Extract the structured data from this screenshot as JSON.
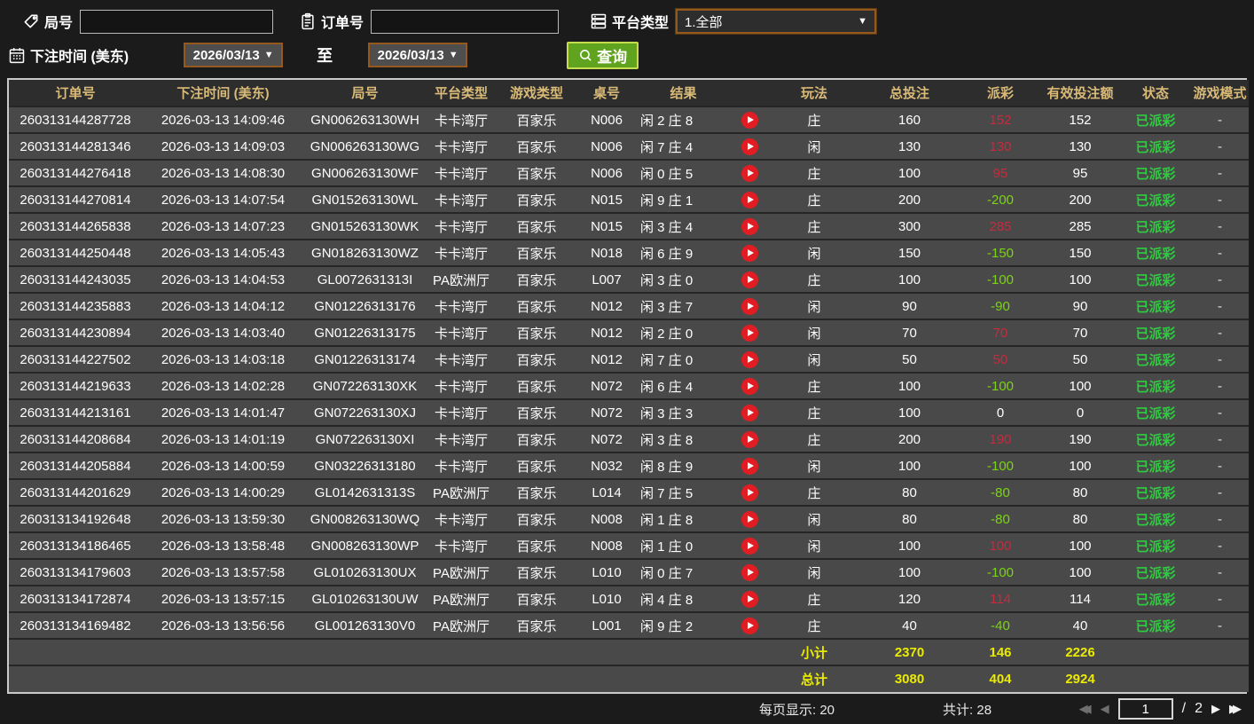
{
  "filters": {
    "round_label": "局号",
    "round_value": "",
    "order_label": "订单号",
    "order_value": "",
    "platform_label": "平台类型",
    "platform_value": "1.全部",
    "bet_time_label": "下注时间 (美东)",
    "date_from": "2026/03/13",
    "to_label": "至",
    "date_to": "2026/03/13",
    "search_label": "查询"
  },
  "table": {
    "columns": [
      "订单号",
      "下注时间 (美东)",
      "局号",
      "平台类型",
      "游戏类型",
      "桌号",
      "结果",
      "",
      "玩法",
      "总投注",
      "派彩",
      "有效投注额",
      "状态",
      "游戏模式"
    ],
    "rows": [
      {
        "order": "260313144287728",
        "time": "2026-03-13 14:09:46",
        "round": "GN006263130WH",
        "platform": "卡卡湾厅",
        "game": "百家乐",
        "table": "N006",
        "result": "闲 2 庄 8",
        "bet": "庄",
        "total": "160",
        "payout": "152",
        "valid": "152",
        "status": "已派彩",
        "mode": "-"
      },
      {
        "order": "260313144281346",
        "time": "2026-03-13 14:09:03",
        "round": "GN006263130WG",
        "platform": "卡卡湾厅",
        "game": "百家乐",
        "table": "N006",
        "result": "闲 7 庄 4",
        "bet": "闲",
        "total": "130",
        "payout": "130",
        "valid": "130",
        "status": "已派彩",
        "mode": "-"
      },
      {
        "order": "260313144276418",
        "time": "2026-03-13 14:08:30",
        "round": "GN006263130WF",
        "platform": "卡卡湾厅",
        "game": "百家乐",
        "table": "N006",
        "result": "闲 0 庄 5",
        "bet": "庄",
        "total": "100",
        "payout": "95",
        "valid": "95",
        "status": "已派彩",
        "mode": "-"
      },
      {
        "order": "260313144270814",
        "time": "2026-03-13 14:07:54",
        "round": "GN015263130WL",
        "platform": "卡卡湾厅",
        "game": "百家乐",
        "table": "N015",
        "result": "闲 9 庄 1",
        "bet": "庄",
        "total": "200",
        "payout": "-200",
        "valid": "200",
        "status": "已派彩",
        "mode": "-"
      },
      {
        "order": "260313144265838",
        "time": "2026-03-13 14:07:23",
        "round": "GN015263130WK",
        "platform": "卡卡湾厅",
        "game": "百家乐",
        "table": "N015",
        "result": "闲 3 庄 4",
        "bet": "庄",
        "total": "300",
        "payout": "285",
        "valid": "285",
        "status": "已派彩",
        "mode": "-"
      },
      {
        "order": "260313144250448",
        "time": "2026-03-13 14:05:43",
        "round": "GN018263130WZ",
        "platform": "卡卡湾厅",
        "game": "百家乐",
        "table": "N018",
        "result": "闲 6 庄 9",
        "bet": "闲",
        "total": "150",
        "payout": "-150",
        "valid": "150",
        "status": "已派彩",
        "mode": "-"
      },
      {
        "order": "260313144243035",
        "time": "2026-03-13 14:04:53",
        "round": "GL0072631313I",
        "platform": "PA欧洲厅",
        "game": "百家乐",
        "table": "L007",
        "result": "闲 3 庄 0",
        "bet": "庄",
        "total": "100",
        "payout": "-100",
        "valid": "100",
        "status": "已派彩",
        "mode": "-"
      },
      {
        "order": "260313144235883",
        "time": "2026-03-13 14:04:12",
        "round": "GN01226313176",
        "platform": "卡卡湾厅",
        "game": "百家乐",
        "table": "N012",
        "result": "闲 3 庄 7",
        "bet": "闲",
        "total": "90",
        "payout": "-90",
        "valid": "90",
        "status": "已派彩",
        "mode": "-"
      },
      {
        "order": "260313144230894",
        "time": "2026-03-13 14:03:40",
        "round": "GN01226313175",
        "platform": "卡卡湾厅",
        "game": "百家乐",
        "table": "N012",
        "result": "闲 2 庄 0",
        "bet": "闲",
        "total": "70",
        "payout": "70",
        "valid": "70",
        "status": "已派彩",
        "mode": "-"
      },
      {
        "order": "260313144227502",
        "time": "2026-03-13 14:03:18",
        "round": "GN01226313174",
        "platform": "卡卡湾厅",
        "game": "百家乐",
        "table": "N012",
        "result": "闲 7 庄 0",
        "bet": "闲",
        "total": "50",
        "payout": "50",
        "valid": "50",
        "status": "已派彩",
        "mode": "-"
      },
      {
        "order": "260313144219633",
        "time": "2026-03-13 14:02:28",
        "round": "GN072263130XK",
        "platform": "卡卡湾厅",
        "game": "百家乐",
        "table": "N072",
        "result": "闲 6 庄 4",
        "bet": "庄",
        "total": "100",
        "payout": "-100",
        "valid": "100",
        "status": "已派彩",
        "mode": "-"
      },
      {
        "order": "260313144213161",
        "time": "2026-03-13 14:01:47",
        "round": "GN072263130XJ",
        "platform": "卡卡湾厅",
        "game": "百家乐",
        "table": "N072",
        "result": "闲 3 庄 3",
        "bet": "庄",
        "total": "100",
        "payout": "0",
        "valid": "0",
        "status": "已派彩",
        "mode": "-"
      },
      {
        "order": "260313144208684",
        "time": "2026-03-13 14:01:19",
        "round": "GN072263130XI",
        "platform": "卡卡湾厅",
        "game": "百家乐",
        "table": "N072",
        "result": "闲 3 庄 8",
        "bet": "庄",
        "total": "200",
        "payout": "190",
        "valid": "190",
        "status": "已派彩",
        "mode": "-"
      },
      {
        "order": "260313144205884",
        "time": "2026-03-13 14:00:59",
        "round": "GN03226313180",
        "platform": "卡卡湾厅",
        "game": "百家乐",
        "table": "N032",
        "result": "闲 8 庄 9",
        "bet": "闲",
        "total": "100",
        "payout": "-100",
        "valid": "100",
        "status": "已派彩",
        "mode": "-"
      },
      {
        "order": "260313144201629",
        "time": "2026-03-13 14:00:29",
        "round": "GL0142631313S",
        "platform": "PA欧洲厅",
        "game": "百家乐",
        "table": "L014",
        "result": "闲 7 庄 5",
        "bet": "庄",
        "total": "80",
        "payout": "-80",
        "valid": "80",
        "status": "已派彩",
        "mode": "-"
      },
      {
        "order": "260313134192648",
        "time": "2026-03-13 13:59:30",
        "round": "GN008263130WQ",
        "platform": "卡卡湾厅",
        "game": "百家乐",
        "table": "N008",
        "result": "闲 1 庄 8",
        "bet": "闲",
        "total": "80",
        "payout": "-80",
        "valid": "80",
        "status": "已派彩",
        "mode": "-"
      },
      {
        "order": "260313134186465",
        "time": "2026-03-13 13:58:48",
        "round": "GN008263130WP",
        "platform": "卡卡湾厅",
        "game": "百家乐",
        "table": "N008",
        "result": "闲 1 庄 0",
        "bet": "闲",
        "total": "100",
        "payout": "100",
        "valid": "100",
        "status": "已派彩",
        "mode": "-"
      },
      {
        "order": "260313134179603",
        "time": "2026-03-13 13:57:58",
        "round": "GL010263130UX",
        "platform": "PA欧洲厅",
        "game": "百家乐",
        "table": "L010",
        "result": "闲 0 庄 7",
        "bet": "闲",
        "total": "100",
        "payout": "-100",
        "valid": "100",
        "status": "已派彩",
        "mode": "-"
      },
      {
        "order": "260313134172874",
        "time": "2026-03-13 13:57:15",
        "round": "GL010263130UW",
        "platform": "PA欧洲厅",
        "game": "百家乐",
        "table": "L010",
        "result": "闲 4 庄 8",
        "bet": "庄",
        "total": "120",
        "payout": "114",
        "valid": "114",
        "status": "已派彩",
        "mode": "-"
      },
      {
        "order": "260313134169482",
        "time": "2026-03-13 13:56:56",
        "round": "GL001263130V0",
        "platform": "PA欧洲厅",
        "game": "百家乐",
        "table": "L001",
        "result": "闲 9 庄 2",
        "bet": "庄",
        "total": "40",
        "payout": "-40",
        "valid": "40",
        "status": "已派彩",
        "mode": "-"
      }
    ],
    "subtotal": {
      "label": "小计",
      "total": "2370",
      "payout": "146",
      "valid": "2226"
    },
    "grand_total": {
      "label": "总计",
      "total": "3080",
      "payout": "404",
      "valid": "2924"
    }
  },
  "footer": {
    "per_page_text": "每页显示: 20",
    "total_text": "共计: 28",
    "current_page": "1",
    "page_separator": "/",
    "total_pages": "2"
  },
  "colors": {
    "page_bg": "#1b1b1b",
    "row_bg": "#494949",
    "header_bg": "#2d2d2d",
    "separator": "#262626",
    "header_text": "#d9ba77",
    "payout_positive": "#c62b3e",
    "payout_negative": "#7bd414",
    "status_settled": "#2ecc40",
    "summary_text": "#ebeb00",
    "accent_orange_border": "#95591d",
    "search_green": "#5fa31e",
    "search_border": "#c6dd4f",
    "play_red": "#e11d23"
  }
}
